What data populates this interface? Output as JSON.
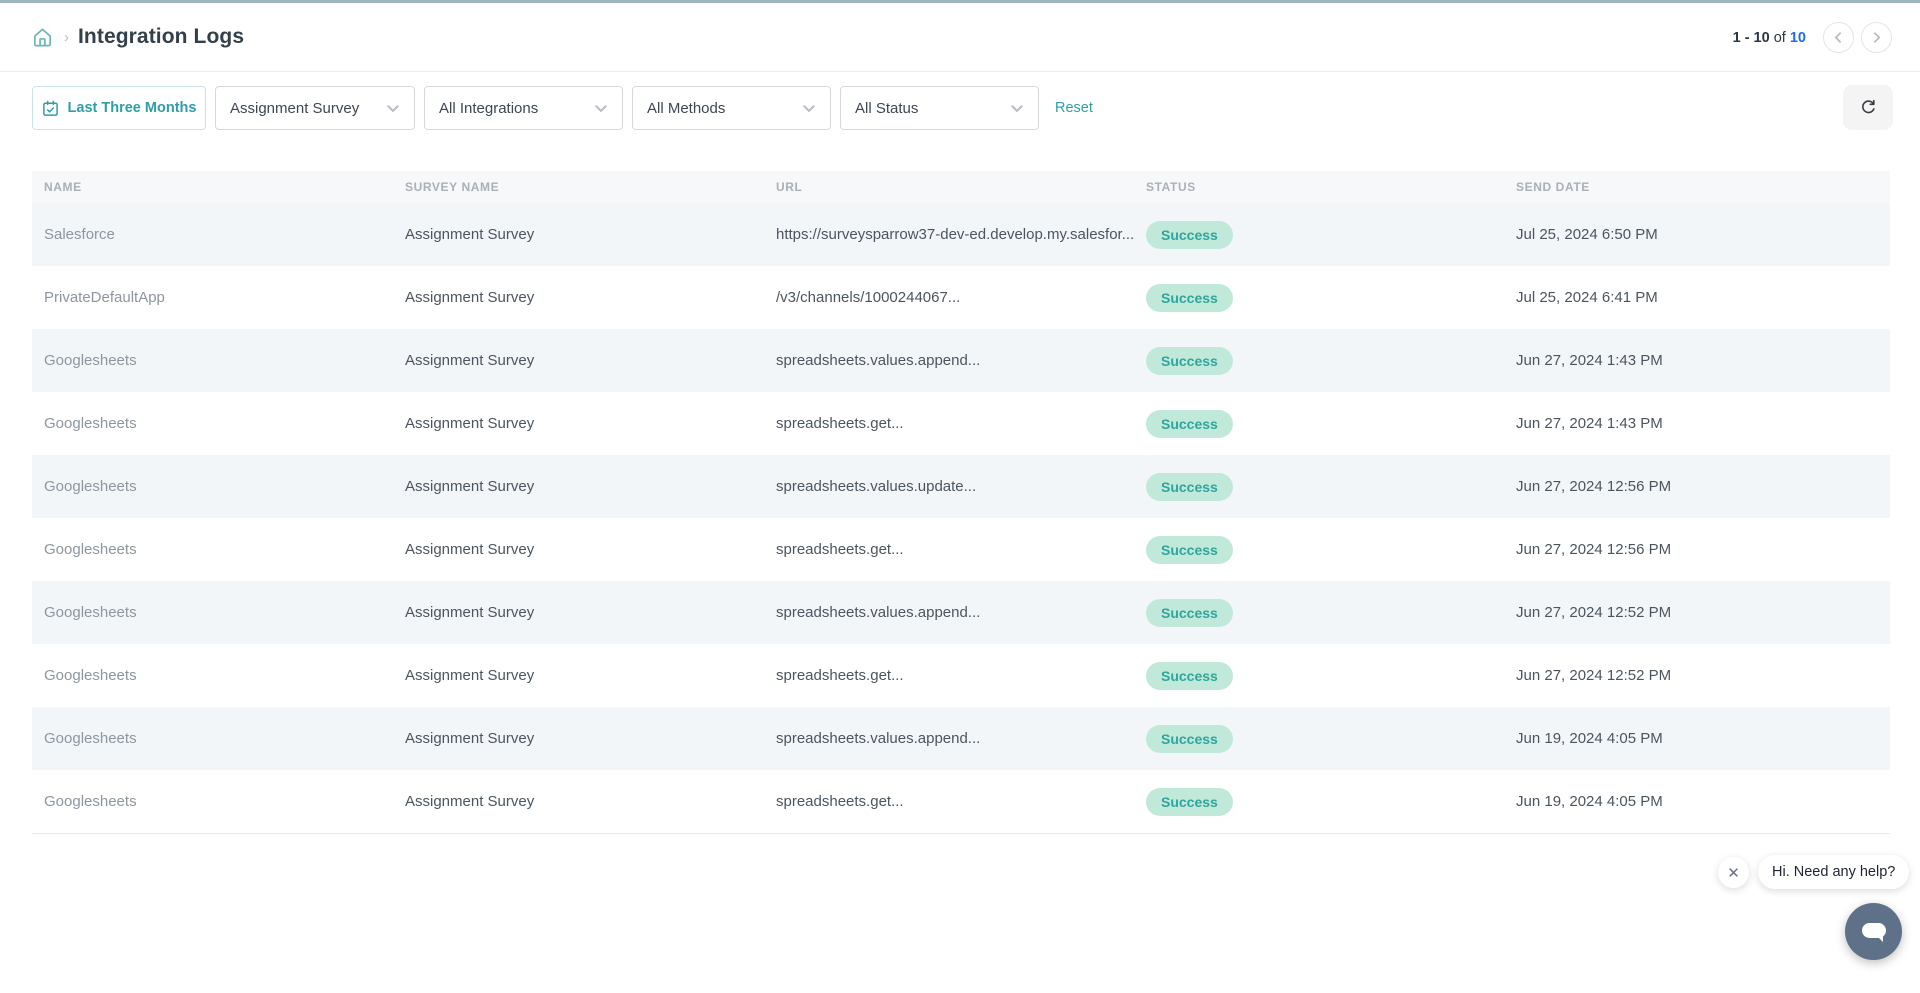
{
  "header": {
    "title": "Integration Logs",
    "pagination": {
      "range": "1 - 10",
      "of_label": "of",
      "total": "10"
    }
  },
  "filters": {
    "date_range_label": "Last Three Months",
    "survey_value": "Assignment Survey",
    "integration_value": "All Integrations",
    "method_value": "All Methods",
    "status_value": "All Status",
    "reset_label": "Reset"
  },
  "icons": {
    "home": "home-icon",
    "calendar": "calendar-check-icon",
    "refresh": "refresh-icon",
    "chevron_down": "chevron-down-icon",
    "chat": "chat-bubble-icon",
    "close": "close-icon"
  },
  "colors": {
    "accent_teal": "#2f9daa",
    "top_strip": "#9cb8bd",
    "link_blue": "#1c6cf2",
    "badge_bg": "#c1e9da",
    "badge_text": "#2ea69e",
    "stripe": "#f3f6f9",
    "chat_button": "#5e7189"
  },
  "table": {
    "columns": [
      "NAME",
      "SURVEY NAME",
      "URL",
      "STATUS",
      "SEND DATE"
    ],
    "rows": [
      {
        "name": "Salesforce",
        "survey": "Assignment Survey",
        "url": "https://surveysparrow37-dev-ed.develop.my.salesfor...",
        "status": "Success",
        "date": "Jul 25, 2024 6:50 PM"
      },
      {
        "name": "PrivateDefaultApp",
        "survey": "Assignment Survey",
        "url": "/v3/channels/1000244067...",
        "status": "Success",
        "date": "Jul 25, 2024 6:41 PM"
      },
      {
        "name": "Googlesheets",
        "survey": "Assignment Survey",
        "url": "spreadsheets.values.append...",
        "status": "Success",
        "date": "Jun 27, 2024 1:43 PM"
      },
      {
        "name": "Googlesheets",
        "survey": "Assignment Survey",
        "url": "spreadsheets.get...",
        "status": "Success",
        "date": "Jun 27, 2024 1:43 PM"
      },
      {
        "name": "Googlesheets",
        "survey": "Assignment Survey",
        "url": "spreadsheets.values.update...",
        "status": "Success",
        "date": "Jun 27, 2024 12:56 PM"
      },
      {
        "name": "Googlesheets",
        "survey": "Assignment Survey",
        "url": "spreadsheets.get...",
        "status": "Success",
        "date": "Jun 27, 2024 12:56 PM"
      },
      {
        "name": "Googlesheets",
        "survey": "Assignment Survey",
        "url": "spreadsheets.values.append...",
        "status": "Success",
        "date": "Jun 27, 2024 12:52 PM"
      },
      {
        "name": "Googlesheets",
        "survey": "Assignment Survey",
        "url": "spreadsheets.get...",
        "status": "Success",
        "date": "Jun 27, 2024 12:52 PM"
      },
      {
        "name": "Googlesheets",
        "survey": "Assignment Survey",
        "url": "spreadsheets.values.append...",
        "status": "Success",
        "date": "Jun 19, 2024 4:05 PM"
      },
      {
        "name": "Googlesheets",
        "survey": "Assignment Survey",
        "url": "spreadsheets.get...",
        "status": "Success",
        "date": "Jun 19, 2024 4:05 PM"
      }
    ]
  },
  "chat": {
    "tooltip": "Hi. Need any help?"
  }
}
